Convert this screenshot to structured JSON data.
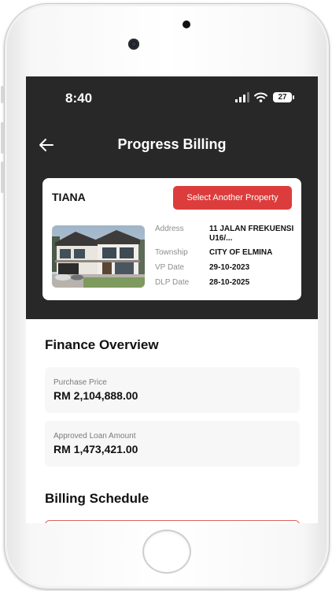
{
  "status_bar": {
    "time": "8:40",
    "battery": "27",
    "icons": [
      "signal-icon",
      "wifi-icon",
      "battery-icon"
    ]
  },
  "nav": {
    "title": "Progress Billing",
    "back_icon": "arrow-left-icon"
  },
  "property": {
    "name": "TIANA",
    "select_button": "Select Another Property",
    "details": [
      {
        "label": "Address",
        "value": "11 JALAN FREKUENSI U16/..."
      },
      {
        "label": "Township",
        "value": "CITY OF ELMINA"
      },
      {
        "label": "VP Date",
        "value": "29-10-2023"
      },
      {
        "label": "DLP Date",
        "value": "28-10-2025"
      }
    ]
  },
  "finance": {
    "title": "Finance Overview",
    "purchase_price": {
      "label": "Purchase Price",
      "value": "RM 2,104,888.00"
    },
    "approved_loan": {
      "label": "Approved Loan Amount",
      "value": "RM 1,473,421.00"
    }
  },
  "billing": {
    "title": "Billing Schedule"
  },
  "colors": {
    "header": "#282828",
    "accent": "#dd3c3c",
    "card": "#f7f7f7"
  }
}
